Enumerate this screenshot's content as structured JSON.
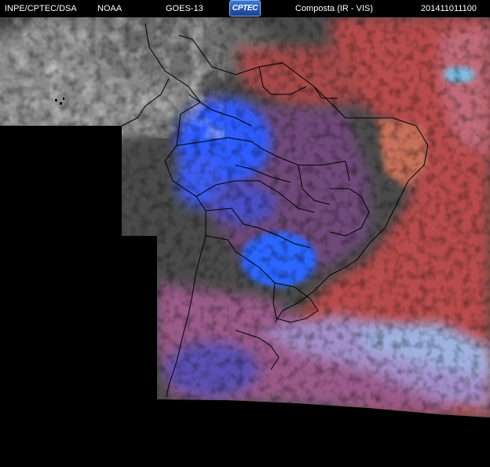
{
  "header": {
    "source": "INPE/CPTEC/DSA",
    "agency": "NOAA",
    "satellite": "GOES-13",
    "logo_text": "CPTEC",
    "product": "Composta (IR - VIS)",
    "timestamp": "201411011100"
  },
  "colors": {
    "background": "#000000",
    "header_text": "#ffffff",
    "cold_cloud_blue": "#2f5cff",
    "warm_red": "#c0504a",
    "land_gray": "#4a4a4a",
    "border_line": "#000000"
  }
}
